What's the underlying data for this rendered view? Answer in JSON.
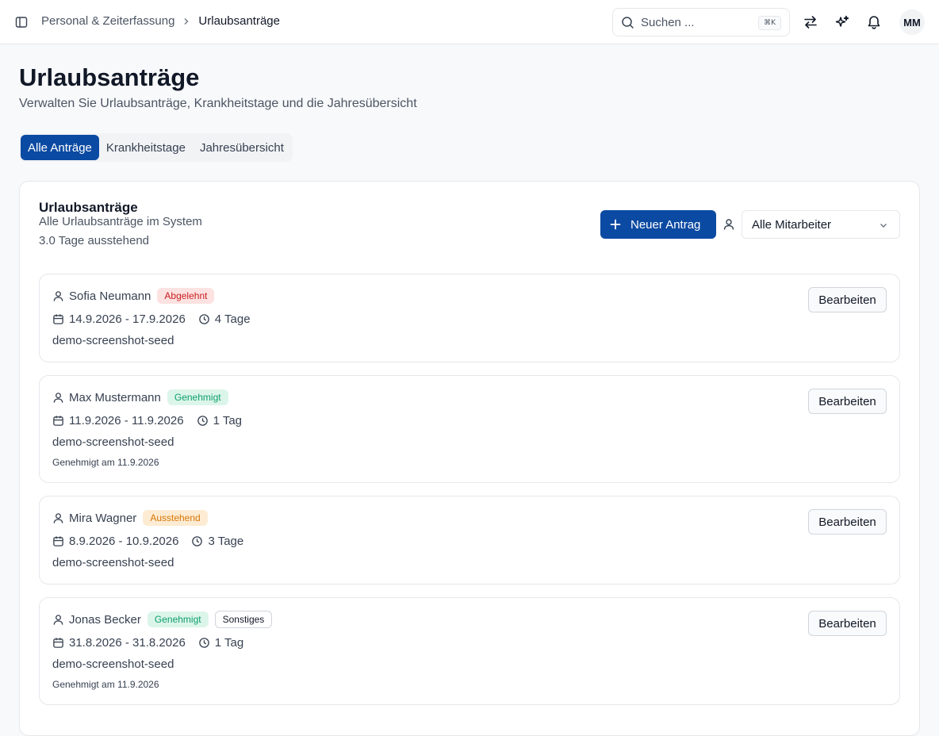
{
  "header": {
    "breadcrumb": {
      "parent": "Personal & Zeiterfassung",
      "current": "Urlaubsanträge"
    },
    "search": {
      "placeholder": "Suchen ...",
      "shortcut": "⌘K"
    },
    "avatar_initials": "MM",
    "icons": [
      "sidebar-toggle-icon",
      "switch-arrows-icon",
      "sparkles-icon",
      "bell-icon"
    ]
  },
  "page": {
    "title": "Urlaubsanträge",
    "subtitle": "Verwalten Sie Urlaubsanträge, Krankheitstage und die Jahresübersicht"
  },
  "tabs": [
    {
      "label": "Alle Anträge",
      "active": true
    },
    {
      "label": "Krankheitstage",
      "active": false
    },
    {
      "label": "Jahresübersicht",
      "active": false
    }
  ],
  "card": {
    "title": "Urlaubsanträge",
    "description": "Alle Urlaubsanträge im System",
    "pending": "3.0 Tage ausstehend",
    "new_button": "Neuer Antrag",
    "employee_filter": "Alle Mitarbeiter"
  },
  "requests": [
    {
      "name": "Sofia Neumann",
      "status": "Abgelehnt",
      "status_color": "#c81e1e",
      "dates": "14.9.2026 - 17.9.2026",
      "duration": "4 Tage",
      "note": "demo-screenshot-seed",
      "edit_label": "Bearbeiten"
    },
    {
      "name": "Max Mustermann",
      "status": "Genehmigt",
      "status_color": "#0e9f6e",
      "dates": "11.9.2026 - 11.9.2026",
      "duration": "1 Tag",
      "note": "demo-screenshot-seed",
      "approved": "Genehmigt am 11.9.2026",
      "edit_label": "Bearbeiten"
    },
    {
      "name": "Mira Wagner",
      "status": "Ausstehend",
      "status_color": "#d97706",
      "dates": "8.9.2026 - 10.9.2026",
      "duration": "3 Tage",
      "note": "demo-screenshot-seed",
      "edit_label": "Bearbeiten"
    },
    {
      "name": "Jonas Becker",
      "status": "Genehmigt",
      "status_color": "#0e9f6e",
      "type": "Sonstiges",
      "dates": "31.8.2026 - 31.8.2026",
      "duration": "1 Tag",
      "note": "demo-screenshot-seed",
      "approved": "Genehmigt am 11.9.2026",
      "edit_label": "Bearbeiten"
    }
  ],
  "colors": {
    "primary": "#0b4aa2",
    "border": "#e5e7eb",
    "background": "#f8f9fb"
  }
}
